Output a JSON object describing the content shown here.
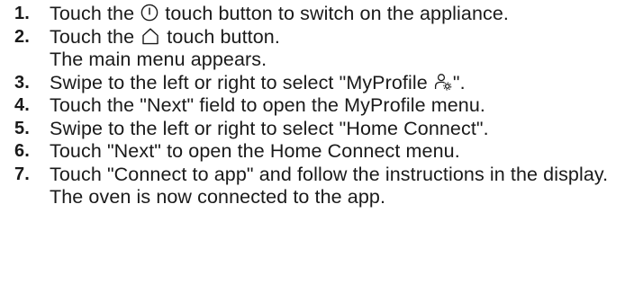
{
  "steps": [
    {
      "number": "1.",
      "text_before": "Touch the ",
      "icon": "power-icon",
      "text_after": " touch button to switch on the appliance.",
      "result": ""
    },
    {
      "number": "2.",
      "text_before": "Touch the ",
      "icon": "home-icon",
      "text_after": " touch button.",
      "result": "The main menu appears."
    },
    {
      "number": "3.",
      "text_before": "Swipe to the left or right to select \"MyProfile ",
      "icon": "profile-settings-icon",
      "text_after": "\".",
      "result": ""
    },
    {
      "number": "4.",
      "text_before": "Touch the \"Next\" field to open the MyProfile menu.",
      "icon": "",
      "text_after": "",
      "result": ""
    },
    {
      "number": "5.",
      "text_before": "Swipe to the left or right to select \"Home Connect\".",
      "icon": "",
      "text_after": "",
      "result": ""
    },
    {
      "number": "6.",
      "text_before": "Touch \"Next\" to open the Home Connect menu.",
      "icon": "",
      "text_after": "",
      "result": ""
    },
    {
      "number": "7.",
      "text_before": "Touch \"Connect to app\" and follow the instructions in the display.",
      "icon": "",
      "text_after": "",
      "result": "The oven is now connected to the app."
    }
  ]
}
